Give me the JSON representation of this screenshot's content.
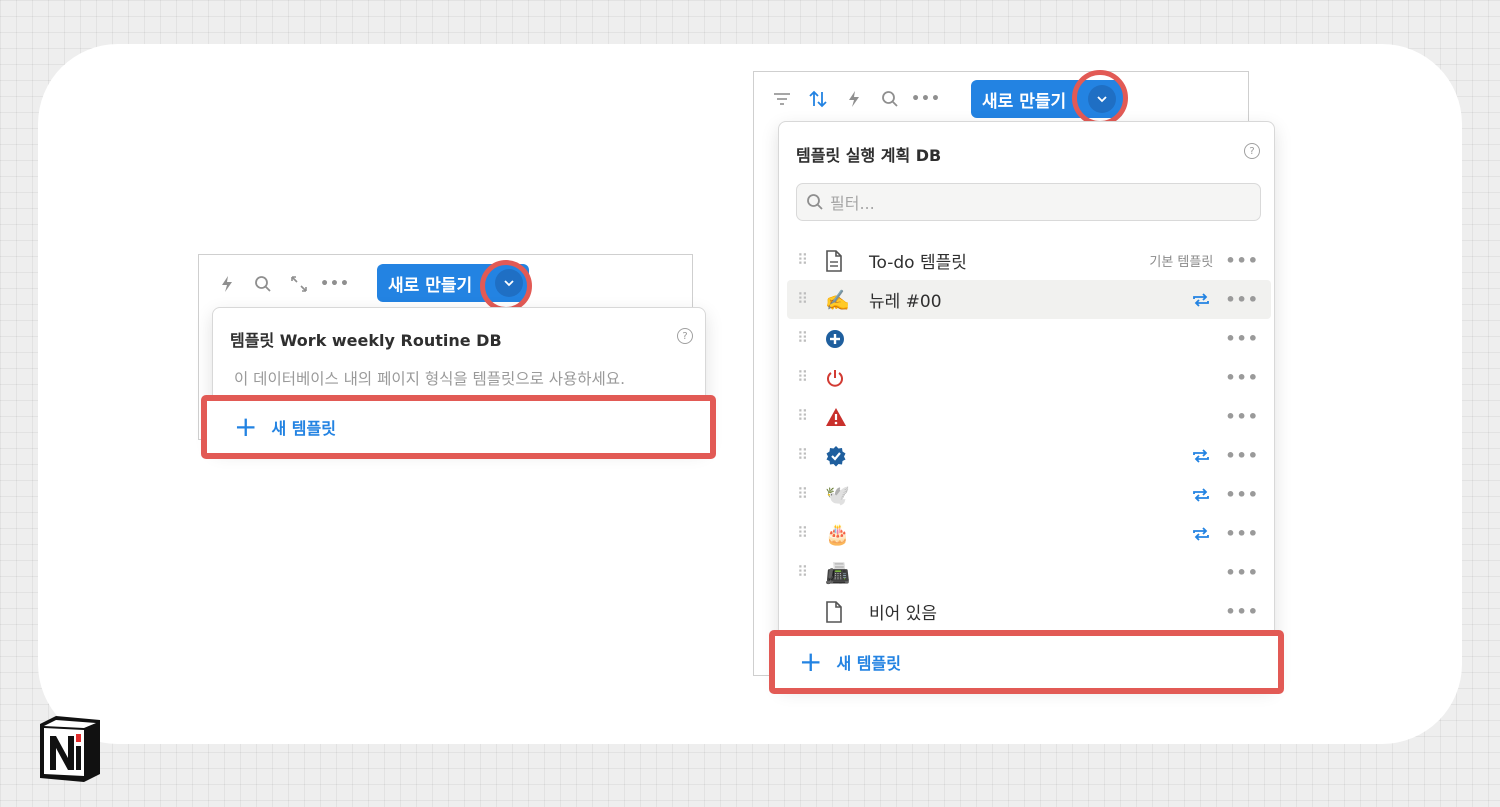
{
  "left_panel": {
    "new_button_label": "새로 만들기",
    "popup_title": "템플릿 Work weekly Routine DB",
    "help_mark": "?",
    "description": "이 데이터베이스 내의 페이지 형식을 템플릿으로 사용하세요.",
    "new_template_label": "새 템플릿",
    "new_template_plus": "+",
    "more_dots": "•••"
  },
  "right_panel": {
    "new_button_label": "새로 만들기",
    "popup_title": "템플릿 실행 계획 DB",
    "help_mark": "?",
    "search_placeholder": "필터...",
    "templates": [
      {
        "icon": "document-icon",
        "label": "To-do 템플릿",
        "badge": "기본 템플릿",
        "repeat": false
      },
      {
        "icon": "✍️",
        "label": "뉴레 #00",
        "badge": "",
        "repeat": true
      },
      {
        "icon": "plus-circle-icon",
        "label": "",
        "badge": "",
        "repeat": false
      },
      {
        "icon": "power-icon",
        "label": "",
        "badge": "",
        "repeat": false
      },
      {
        "icon": "warning-icon",
        "label": "",
        "badge": "",
        "repeat": false
      },
      {
        "icon": "verified-check-icon",
        "label": "",
        "badge": "",
        "repeat": true
      },
      {
        "icon": "🕊️",
        "label": "",
        "badge": "",
        "repeat": true
      },
      {
        "icon": "🎂",
        "label": "",
        "badge": "",
        "repeat": true
      },
      {
        "icon": "📠",
        "label": "",
        "badge": "",
        "repeat": false
      },
      {
        "icon": "document-icon",
        "label": "비어 있음",
        "badge": "",
        "repeat": false
      }
    ],
    "new_template_label": "새 템플릿",
    "new_template_plus": "+",
    "more_dots": "•••"
  },
  "colors": {
    "accent_blue": "#2383e2",
    "highlight_red": "#e25a55"
  }
}
